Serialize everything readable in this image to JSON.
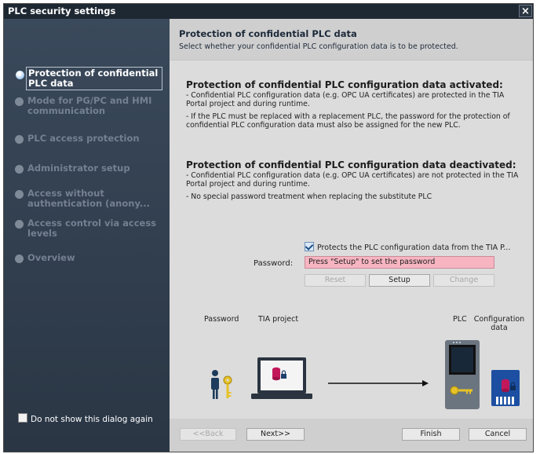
{
  "window": {
    "title": "PLC security settings",
    "close_glyph": "×"
  },
  "sidebar": {
    "items": [
      {
        "label": "Protection of confidential PLC data",
        "active": true
      },
      {
        "label": "Mode for PG/PC and HMI communication",
        "active": false
      },
      {
        "label": "PLC access protection",
        "active": false
      },
      {
        "label": "Administrator setup",
        "active": false
      },
      {
        "label": "Access without authentication (anony...",
        "active": false
      },
      {
        "label": "Access control via access levels",
        "active": false
      },
      {
        "label": "Overview",
        "active": false
      }
    ],
    "dont_show_label": "Do not show this dialog again",
    "dont_show_checked": false
  },
  "header": {
    "title": "Protection of confidential PLC data",
    "subtitle": "Select whether your confidential PLC configuration data is to be protected."
  },
  "activated": {
    "title": "Protection of confidential PLC configuration data activated:",
    "line1": "- Confidential PLC configuration data (e.g. OPC UA certificates) are protected in the TIA Portal project and during runtime.",
    "line2": "- If the PLC must be replaced with a replacement PLC, the password for the protection of confidential PLC configuration data must also be assigned for the new PLC."
  },
  "deactivated": {
    "title": "Protection of confidential PLC configuration data deactivated:",
    "line1": "- Confidential PLC configuration data (e.g. OPC UA certificates) are not protected in the TIA Portal project and during runtime.",
    "line2": "- No special password treatment when replacing the substitute PLC"
  },
  "protect": {
    "checkbox_label": "Protects the PLC configuration data from the TIA P...",
    "checked": true
  },
  "password": {
    "label": "Password:",
    "value": "Press \"Setup\" to set the password"
  },
  "buttons": {
    "reset": "Reset",
    "setup": "Setup",
    "change": "Change",
    "back": "<<Back",
    "next": "Next>>",
    "finish": "Finish",
    "cancel": "Cancel"
  },
  "illustration": {
    "password": "Password",
    "tia_project": "TIA project",
    "plc": "PLC",
    "configuration_data": "Configuration data"
  },
  "colors": {
    "accent": "#3b88d6",
    "password_field": "#f7b5c1",
    "sidebar": "#3a4656"
  }
}
